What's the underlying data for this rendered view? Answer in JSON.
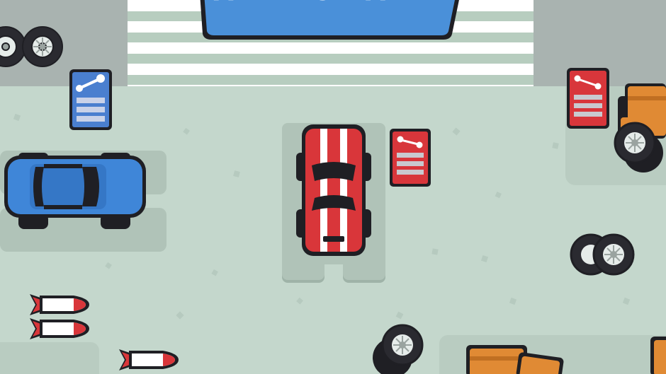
{
  "sign": {
    "title": "ALIEN CLEANER"
  },
  "colors": {
    "ground": "#c4d7cc",
    "wall": "#a8b2af",
    "sign_blue": "#4a90d9",
    "car_red": "#d9363a",
    "car_blue": "#3f86d8",
    "crate_orange": "#e08a34",
    "outline": "#1f1f24"
  },
  "icons": {
    "upgrade_station": "wrench-icon"
  },
  "objects": {
    "player_car": "red-striped-car",
    "parked_car": "blue-car",
    "upgrade_stations": [
      "blue-station",
      "red-station",
      "red-station"
    ],
    "tires": "tire-stack",
    "rockets": "rocket",
    "crates": "orange-crate"
  }
}
